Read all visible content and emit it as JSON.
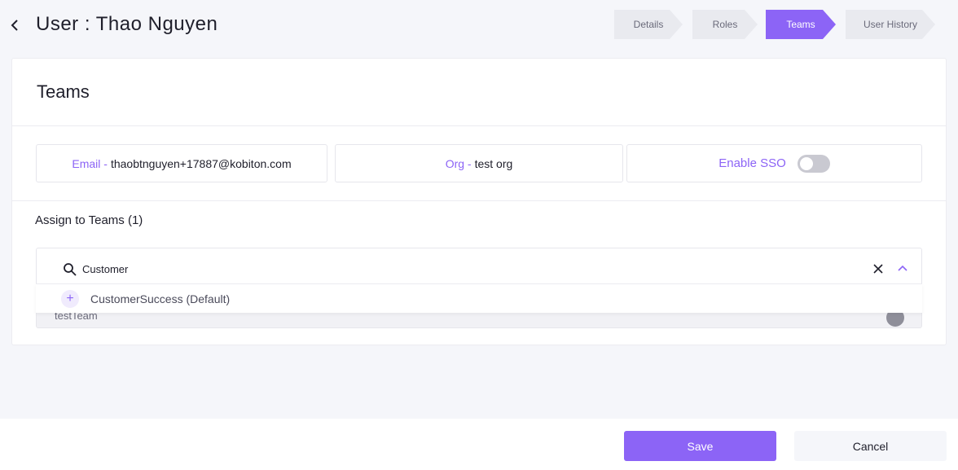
{
  "header": {
    "back_icon": "chevron-left-icon",
    "title": "User : Thao Nguyen"
  },
  "steps": [
    {
      "label": "Details",
      "active": false
    },
    {
      "label": "Roles",
      "active": false
    },
    {
      "label": "Teams",
      "active": true
    },
    {
      "label": "User History",
      "active": false
    }
  ],
  "card": {
    "title": "Teams",
    "email": {
      "label": "Email -",
      "value": "thaobtnguyen+17887@kobiton.com"
    },
    "org": {
      "label": "Org -",
      "value": "test org"
    },
    "sso": {
      "label": "Enable SSO",
      "enabled": false
    },
    "assign_title": "Assign to Teams (1)",
    "search": {
      "icon": "search-icon",
      "value": "Customer",
      "clear_icon": "close-icon",
      "collapse_icon": "chevron-up-icon"
    },
    "assigned_team": "testTeam",
    "dropdown_options": [
      {
        "icon": "plus-icon",
        "label": "CustomerSuccess (Default)"
      }
    ]
  },
  "footer": {
    "save_label": "Save",
    "cancel_label": "Cancel"
  },
  "colors": {
    "accent": "#8c64f6",
    "background": "#f5f6fa",
    "toggle_off": "#c9c9d1"
  }
}
